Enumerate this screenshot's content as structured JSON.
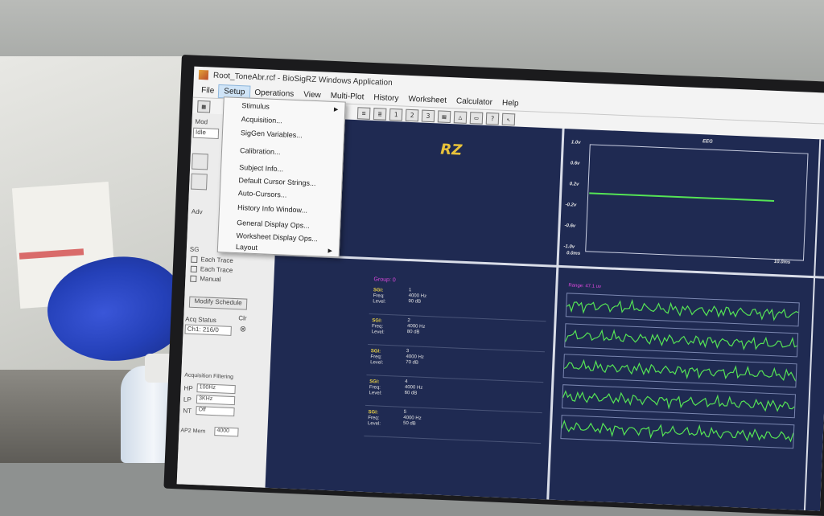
{
  "window": {
    "title": "Root_ToneAbr.rcf - BioSigRZ Windows Application"
  },
  "menubar": {
    "items": [
      "File",
      "Setup",
      "Operations",
      "View",
      "Multi-Plot",
      "History",
      "Worksheet",
      "Calculator",
      "Help"
    ]
  },
  "toolbar": {
    "buttons": [
      "1",
      "2",
      "3"
    ]
  },
  "setup_menu": {
    "items": [
      "Stimulus",
      "Acquisition...",
      "SigGen Variables...",
      "Calibration...",
      "Subject Info...",
      "Default Cursor Strings...",
      "Auto-Cursors...",
      "History Info Window...",
      "General Display Ops...",
      "Worksheet Display Ops...",
      "Layout"
    ]
  },
  "left_panel": {
    "mode_label": "Mod",
    "mode_value": "Idle",
    "adv_label": "Adv",
    "sg_label": "SG",
    "checks": [
      "Each Trace",
      "Each Trace",
      "Manual"
    ],
    "modify_button": "Modify Schedule",
    "acq_status_label": "Acq Status",
    "clr_label": "Clr",
    "acq_status_value": "Ch1: 216/0",
    "filtering_label": "Acquisition Filtering",
    "filters": [
      {
        "label": "HP",
        "value": "100Hz"
      },
      {
        "label": "LP",
        "value": "3KHz"
      },
      {
        "label": "NT",
        "value": "Off"
      }
    ],
    "ap2_mem_label": "AP2 Mem",
    "ap2_mem_value": "4000"
  },
  "eeg_plot": {
    "title": "EEG",
    "y_ticks": [
      "1.0v",
      "0.6v",
      "0.2v",
      "-0.2v",
      "-0.6v",
      "-1.0v"
    ],
    "x_start": "0.0ms",
    "x_end": "10.0ms",
    "trace_level": 0.0,
    "colors": {
      "trace": "#55e455",
      "bg": "#1f2a52"
    }
  },
  "logo_text": "RZ",
  "groups_panel": {
    "group_label": "Group: 0",
    "range_label": "Range: 47.1 uv",
    "rows": [
      {
        "sg": "SGI:",
        "freq_label": "Freq:",
        "level_label": "Level:",
        "index": "1",
        "freq": "4000  Hz",
        "level": "90  dB"
      },
      {
        "sg": "SGI:",
        "freq_label": "Freq:",
        "level_label": "Level:",
        "index": "2",
        "freq": "4000  Hz",
        "level": "80  dB"
      },
      {
        "sg": "SGI:",
        "freq_label": "Freq:",
        "level_label": "Level:",
        "index": "3",
        "freq": "4000  Hz",
        "level": "70  dB"
      },
      {
        "sg": "SGI:",
        "freq_label": "Freq:",
        "level_label": "Level:",
        "index": "4",
        "freq": "4000  Hz",
        "level": "60  dB"
      },
      {
        "sg": "SGI:",
        "freq_label": "Freq:",
        "level_label": "Level:",
        "index": "5",
        "freq": "4000  Hz",
        "level": "50  dB"
      }
    ]
  }
}
